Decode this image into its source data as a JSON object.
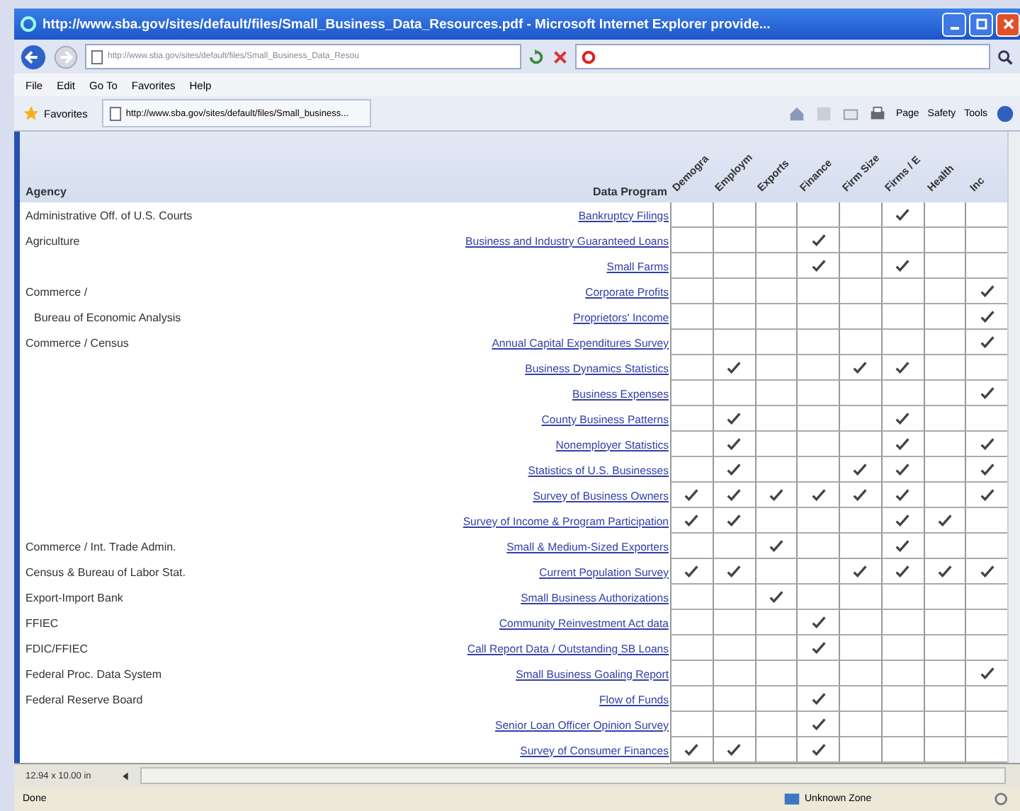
{
  "window": {
    "title": "http://www.sba.gov/sites/default/files/Small_Business_Data_Resources.pdf - Microsoft Internet Explorer provide..."
  },
  "address_bar": {
    "url": "http://www.sba.gov/sites/default/files/Small_Business_Data_Resou"
  },
  "menu": [
    "File",
    "Edit",
    "Go To",
    "Favorites",
    "Help"
  ],
  "favorites_bar": {
    "label": "Favorites",
    "tab": "http://www.sba.gov/sites/default/files/Small_business..."
  },
  "command_bar": [
    "Page",
    "Safety",
    "Tools"
  ],
  "table": {
    "agency_header": "Agency",
    "program_header": "Data Program",
    "columns": [
      "Demogra",
      "Employm",
      "Exports",
      "Finance",
      "Firm Size",
      "Firms / E",
      "Health",
      "Inc"
    ],
    "rows": [
      {
        "agency": "Administrative Off. of U.S. Courts",
        "indented": false,
        "program": "Bankruptcy Filings",
        "checks": [
          false,
          false,
          false,
          false,
          false,
          true,
          false,
          false
        ]
      },
      {
        "agency": "Agriculture",
        "indented": false,
        "program": "Business and Industry Guaranteed Loans",
        "checks": [
          false,
          false,
          false,
          true,
          false,
          false,
          false,
          false
        ]
      },
      {
        "program": "Small Farms",
        "checks": [
          false,
          false,
          false,
          true,
          false,
          true,
          false,
          false
        ]
      },
      {
        "agency": "Commerce /",
        "indented": false,
        "program": "Corporate Profits",
        "checks": [
          false,
          false,
          false,
          false,
          false,
          false,
          false,
          true
        ]
      },
      {
        "agency": "Bureau of Economic Analysis",
        "indented": true,
        "program": "Proprietors' Income",
        "checks": [
          false,
          false,
          false,
          false,
          false,
          false,
          false,
          true
        ]
      },
      {
        "agency": "Commerce / Census",
        "indented": false,
        "program": "Annual Capital Expenditures Survey",
        "checks": [
          false,
          false,
          false,
          false,
          false,
          false,
          false,
          true
        ]
      },
      {
        "program": "Business Dynamics Statistics",
        "checks": [
          false,
          true,
          false,
          false,
          true,
          true,
          false,
          false
        ]
      },
      {
        "program": "Business Expenses",
        "checks": [
          false,
          false,
          false,
          false,
          false,
          false,
          false,
          true
        ]
      },
      {
        "program": "County Business Patterns",
        "checks": [
          false,
          true,
          false,
          false,
          false,
          true,
          false,
          false
        ]
      },
      {
        "program": "Nonemployer Statistics",
        "checks": [
          false,
          true,
          false,
          false,
          false,
          true,
          false,
          true
        ]
      },
      {
        "program": "Statistics of U.S. Businesses",
        "checks": [
          false,
          true,
          false,
          false,
          true,
          true,
          false,
          true
        ]
      },
      {
        "program": "Survey of Business Owners",
        "checks": [
          true,
          true,
          true,
          true,
          true,
          true,
          false,
          true
        ]
      },
      {
        "program": "Survey of Income & Program Participation",
        "checks": [
          true,
          true,
          false,
          false,
          false,
          true,
          true,
          false
        ]
      },
      {
        "agency": "Commerce / Int. Trade Admin.",
        "indented": false,
        "program": "Small & Medium-Sized Exporters",
        "checks": [
          false,
          false,
          true,
          false,
          false,
          true,
          false,
          false
        ]
      },
      {
        "agency": "Census & Bureau of Labor Stat.",
        "indented": false,
        "program": "Current Population Survey",
        "checks": [
          true,
          true,
          false,
          false,
          true,
          true,
          true,
          true
        ]
      },
      {
        "agency": "Export-Import Bank",
        "indented": false,
        "program": "Small Business Authorizations",
        "checks": [
          false,
          false,
          true,
          false,
          false,
          false,
          false,
          false
        ]
      },
      {
        "agency": "FFIEC",
        "indented": false,
        "program": "Community Reinvestment Act data",
        "checks": [
          false,
          false,
          false,
          true,
          false,
          false,
          false,
          false
        ]
      },
      {
        "agency": "FDIC/FFIEC",
        "indented": false,
        "program": "Call Report Data / Outstanding SB Loans",
        "checks": [
          false,
          false,
          false,
          true,
          false,
          false,
          false,
          false
        ]
      },
      {
        "agency": "Federal Proc. Data System",
        "indented": false,
        "program": "Small Business Goaling Report",
        "checks": [
          false,
          false,
          false,
          false,
          false,
          false,
          false,
          true
        ]
      },
      {
        "agency": "Federal Reserve Board",
        "indented": false,
        "program": "Flow of Funds",
        "checks": [
          false,
          false,
          false,
          true,
          false,
          false,
          false,
          false
        ]
      },
      {
        "program": "Senior Loan Officer Opinion Survey",
        "checks": [
          false,
          false,
          false,
          true,
          false,
          false,
          false,
          false
        ]
      },
      {
        "program": "Survey of Consumer Finances",
        "checks": [
          true,
          true,
          false,
          true,
          false,
          false,
          false,
          false
        ]
      }
    ]
  },
  "page_size": "12.94 x 10.00 in",
  "status_bar": {
    "text": "Done",
    "zone": "Unknown Zone"
  }
}
